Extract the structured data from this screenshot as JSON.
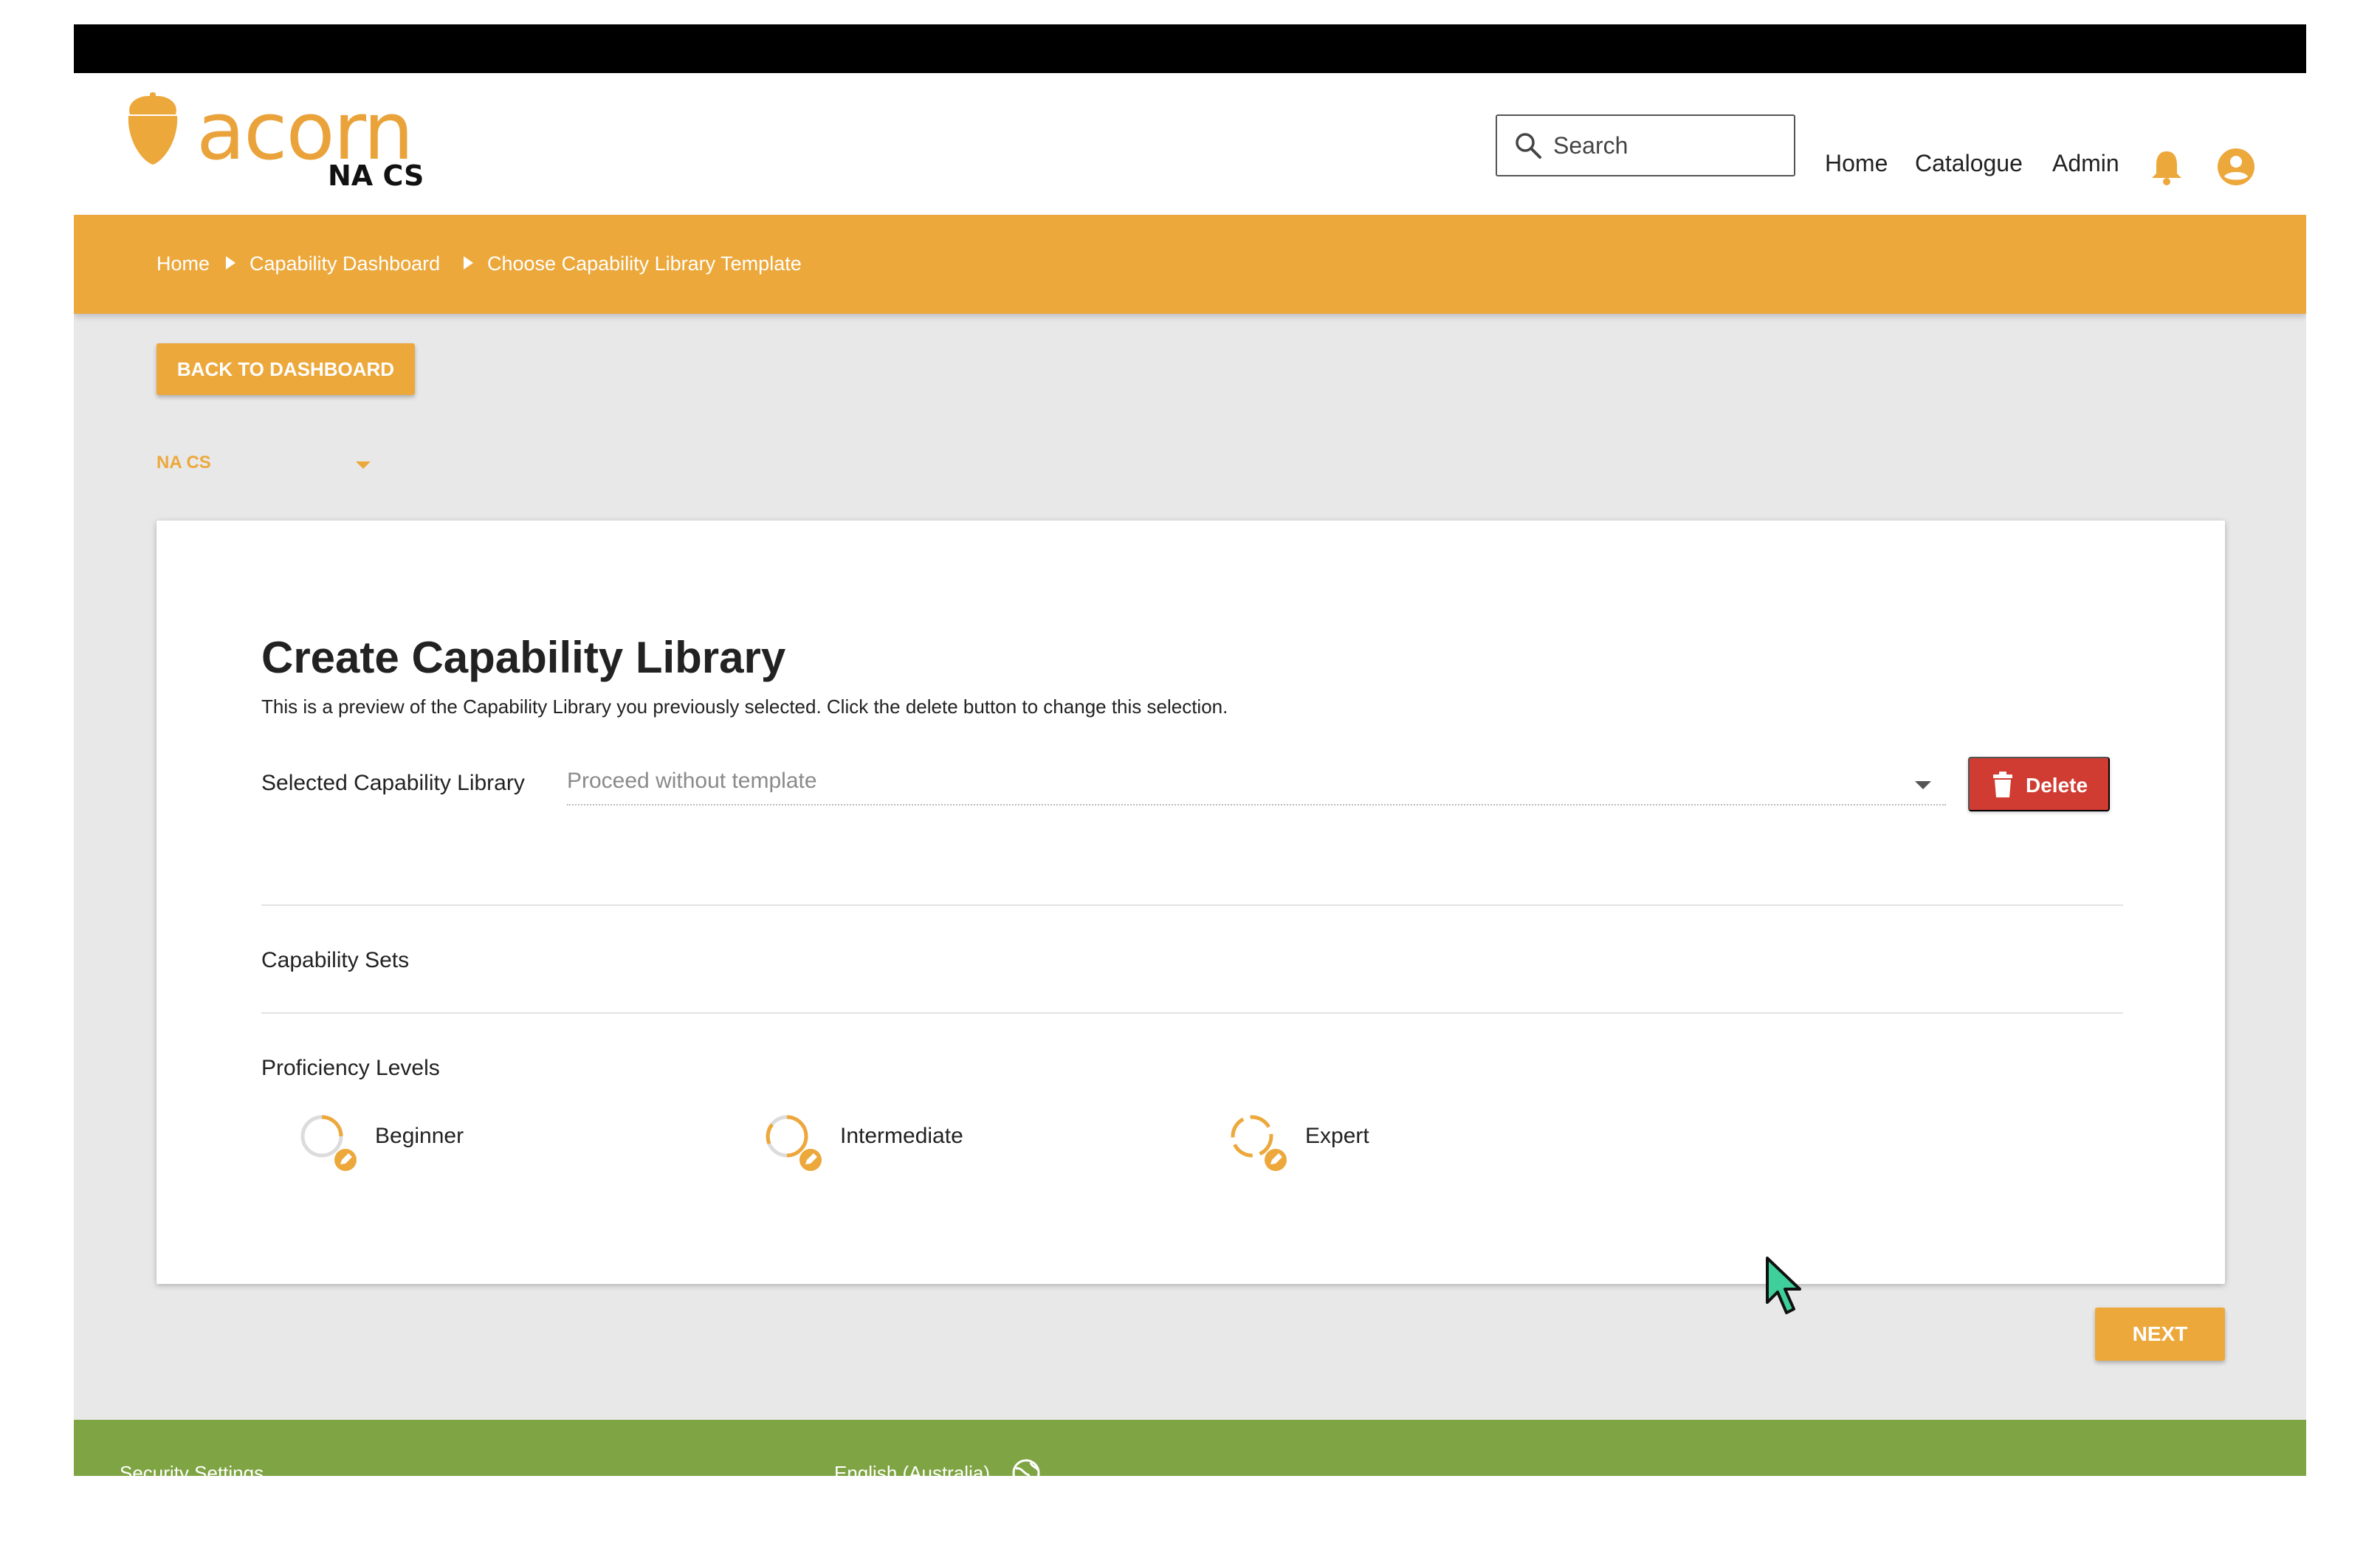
{
  "app": {
    "logo_word": "acorn",
    "logo_sub": "NA CS"
  },
  "header": {
    "search_placeholder": "Search",
    "nav": [
      "Home",
      "Catalogue",
      "Admin"
    ],
    "icons": [
      "bell-icon",
      "account-circle-icon"
    ]
  },
  "breadcrumb": [
    "Home",
    "Capability Dashboard",
    "Choose Capability Library Template"
  ],
  "actions": {
    "back_label": "BACK TO DASHBOARD",
    "next_label": "NEXT"
  },
  "org_selector": {
    "value": "NA CS"
  },
  "card": {
    "title": "Create Capability Library",
    "description": "This is a preview of the Capability Library you previously selected. Click the delete button to change this selection.",
    "library_label": "Selected Capability Library",
    "library_value": "Proceed without template",
    "delete_label": "Delete",
    "capability_sets_label": "Capability Sets",
    "proficiency_levels_label": "Proficiency Levels",
    "levels": [
      "Beginner",
      "Intermediate",
      "Expert"
    ]
  },
  "footer": {
    "security_settings": "Security Settings",
    "language": "English (Australia)"
  },
  "colors": {
    "brand_orange": "#eca83b",
    "delete_red": "#d03c31",
    "footer_green": "#7fa443"
  }
}
